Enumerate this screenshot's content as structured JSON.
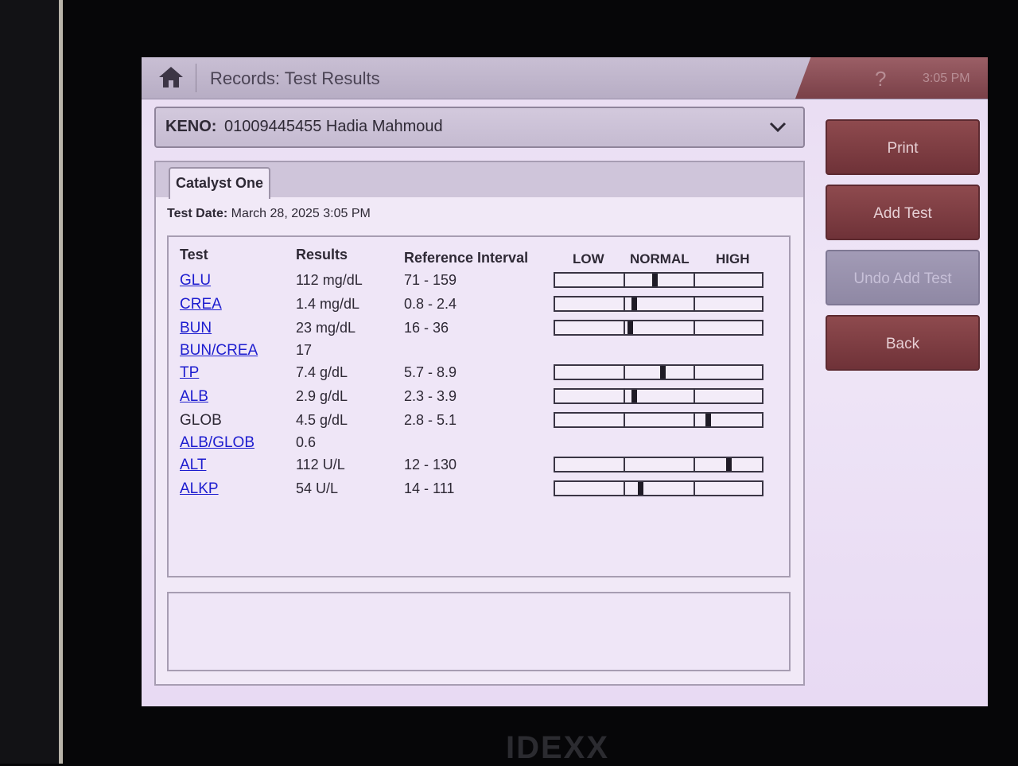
{
  "header": {
    "title": "Records: Test Results",
    "time": "3:05 PM",
    "help_glyph": "?"
  },
  "patient": {
    "label": "KENO:",
    "value": "01009445455 Hadia Mahmoud"
  },
  "tab": {
    "label": "Catalyst One"
  },
  "test_date": {
    "label": "Test Date:",
    "value": "March 28, 2025 3:05 PM"
  },
  "columns": {
    "test": "Test",
    "results": "Results",
    "reference": "Reference Interval",
    "low": "LOW",
    "normal": "NORMAL",
    "high": "HIGH"
  },
  "rows": [
    {
      "test": "GLU",
      "result": "112 mg/dL",
      "ref": "71 - 159",
      "link": true,
      "gauge": 0.48
    },
    {
      "test": "CREA",
      "result": "1.4 mg/dL",
      "ref": "0.8 - 2.4",
      "link": true,
      "gauge": 0.38
    },
    {
      "test": "BUN",
      "result": "23 mg/dL",
      "ref": "16 - 36",
      "link": true,
      "gauge": 0.36
    },
    {
      "test": "BUN/CREA",
      "result": "17",
      "ref": "",
      "link": true,
      "gauge": null
    },
    {
      "test": "TP",
      "result": "7.4 g/dL",
      "ref": "5.7 - 8.9",
      "link": true,
      "gauge": 0.52
    },
    {
      "test": "ALB",
      "result": "2.9 g/dL",
      "ref": "2.3 - 3.9",
      "link": true,
      "gauge": 0.38
    },
    {
      "test": "GLOB",
      "result": "4.5 g/dL",
      "ref": "2.8 - 5.1",
      "link": false,
      "gauge": 0.74
    },
    {
      "test": "ALB/GLOB",
      "result": "0.6",
      "ref": "",
      "link": true,
      "gauge": null
    },
    {
      "test": "ALT",
      "result": "112 U/L",
      "ref": "12 - 130",
      "link": true,
      "gauge": 0.84
    },
    {
      "test": "ALKP",
      "result": "54 U/L",
      "ref": "14 - 111",
      "link": true,
      "gauge": 0.41
    }
  ],
  "buttons": {
    "print": "Print",
    "add_test": "Add Test",
    "undo_add_test": "Undo Add Test",
    "back": "Back"
  },
  "brand": "IDEXX",
  "colors": {
    "accent": "#8e4a4e",
    "link": "#1c1ccf",
    "disabled": "#a29bb6"
  }
}
